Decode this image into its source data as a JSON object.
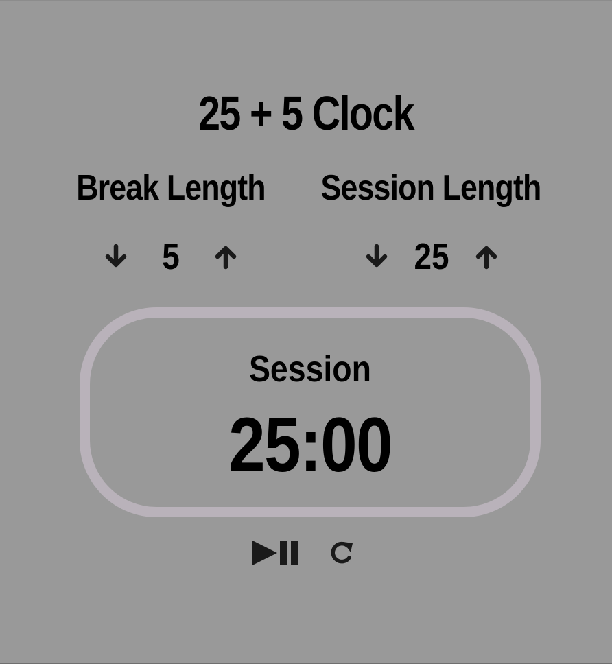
{
  "app": {
    "title": "25 + 5 Clock"
  },
  "break": {
    "label": "Break Length",
    "value": "5",
    "decrement_icon": "arrow-down-icon",
    "increment_icon": "arrow-up-icon"
  },
  "session": {
    "label": "Session Length",
    "value": "25",
    "decrement_icon": "arrow-down-icon",
    "increment_icon": "arrow-up-icon"
  },
  "timer": {
    "label": "Session",
    "time_left": "25:00",
    "border_color": "#b9b2ba"
  },
  "controls": {
    "play_pause_icon": "play-pause-icon",
    "reset_icon": "refresh-icon"
  },
  "colors": {
    "background": "#999999",
    "text": "#000000",
    "icon": "#1a1a1a"
  }
}
